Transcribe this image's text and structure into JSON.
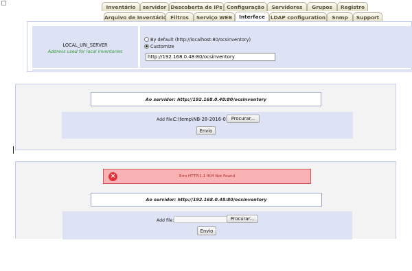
{
  "tabs_row1": [
    "Inventário",
    "servidor",
    "Descoberta de IPs",
    "Configuração",
    "Servidores",
    "Grupos",
    "Registro"
  ],
  "tabs_row2": [
    "Arquivo de Inventário",
    "Filtros",
    "Serviço WEB",
    "Interface",
    "LDAP configuration",
    "Snmp",
    "Support"
  ],
  "active_tab": "Interface",
  "setting": {
    "name": "LOCAL_URI_SERVER",
    "description": "Address used for local inventories",
    "option_default": "By default (http://localhost:80/ocsinventory)",
    "option_customize": "Customize",
    "selected_option": "Customize",
    "value": "http://192.168.0.48:80/ocsinventory"
  },
  "upload_panel_1": {
    "server_label": "Ao servidor: http://192.168.0.48:80/ocsinventory",
    "add_file_label": "Add file:",
    "file_path": "C:\\temp\\NB-28-2016-01-2",
    "browse_button": "Procurar...",
    "submit_button": "Envio"
  },
  "upload_panel_2": {
    "error_message": "Erro HTTP/1.1 404 Not Found",
    "server_label": "Ao servidor: http://192.168.0.48:80/ocsinventory",
    "add_file_label": "Add file:",
    "file_path": "",
    "browse_button": "Procurar...",
    "submit_button": "Envio"
  },
  "icons": {
    "error": "error-x-icon",
    "radio": "radio-button"
  },
  "colors": {
    "panel_bg": "#dde2f5",
    "description_text": "#2f9b2f",
    "error_bg": "#fab3b4",
    "error_icon": "#e2333a"
  }
}
